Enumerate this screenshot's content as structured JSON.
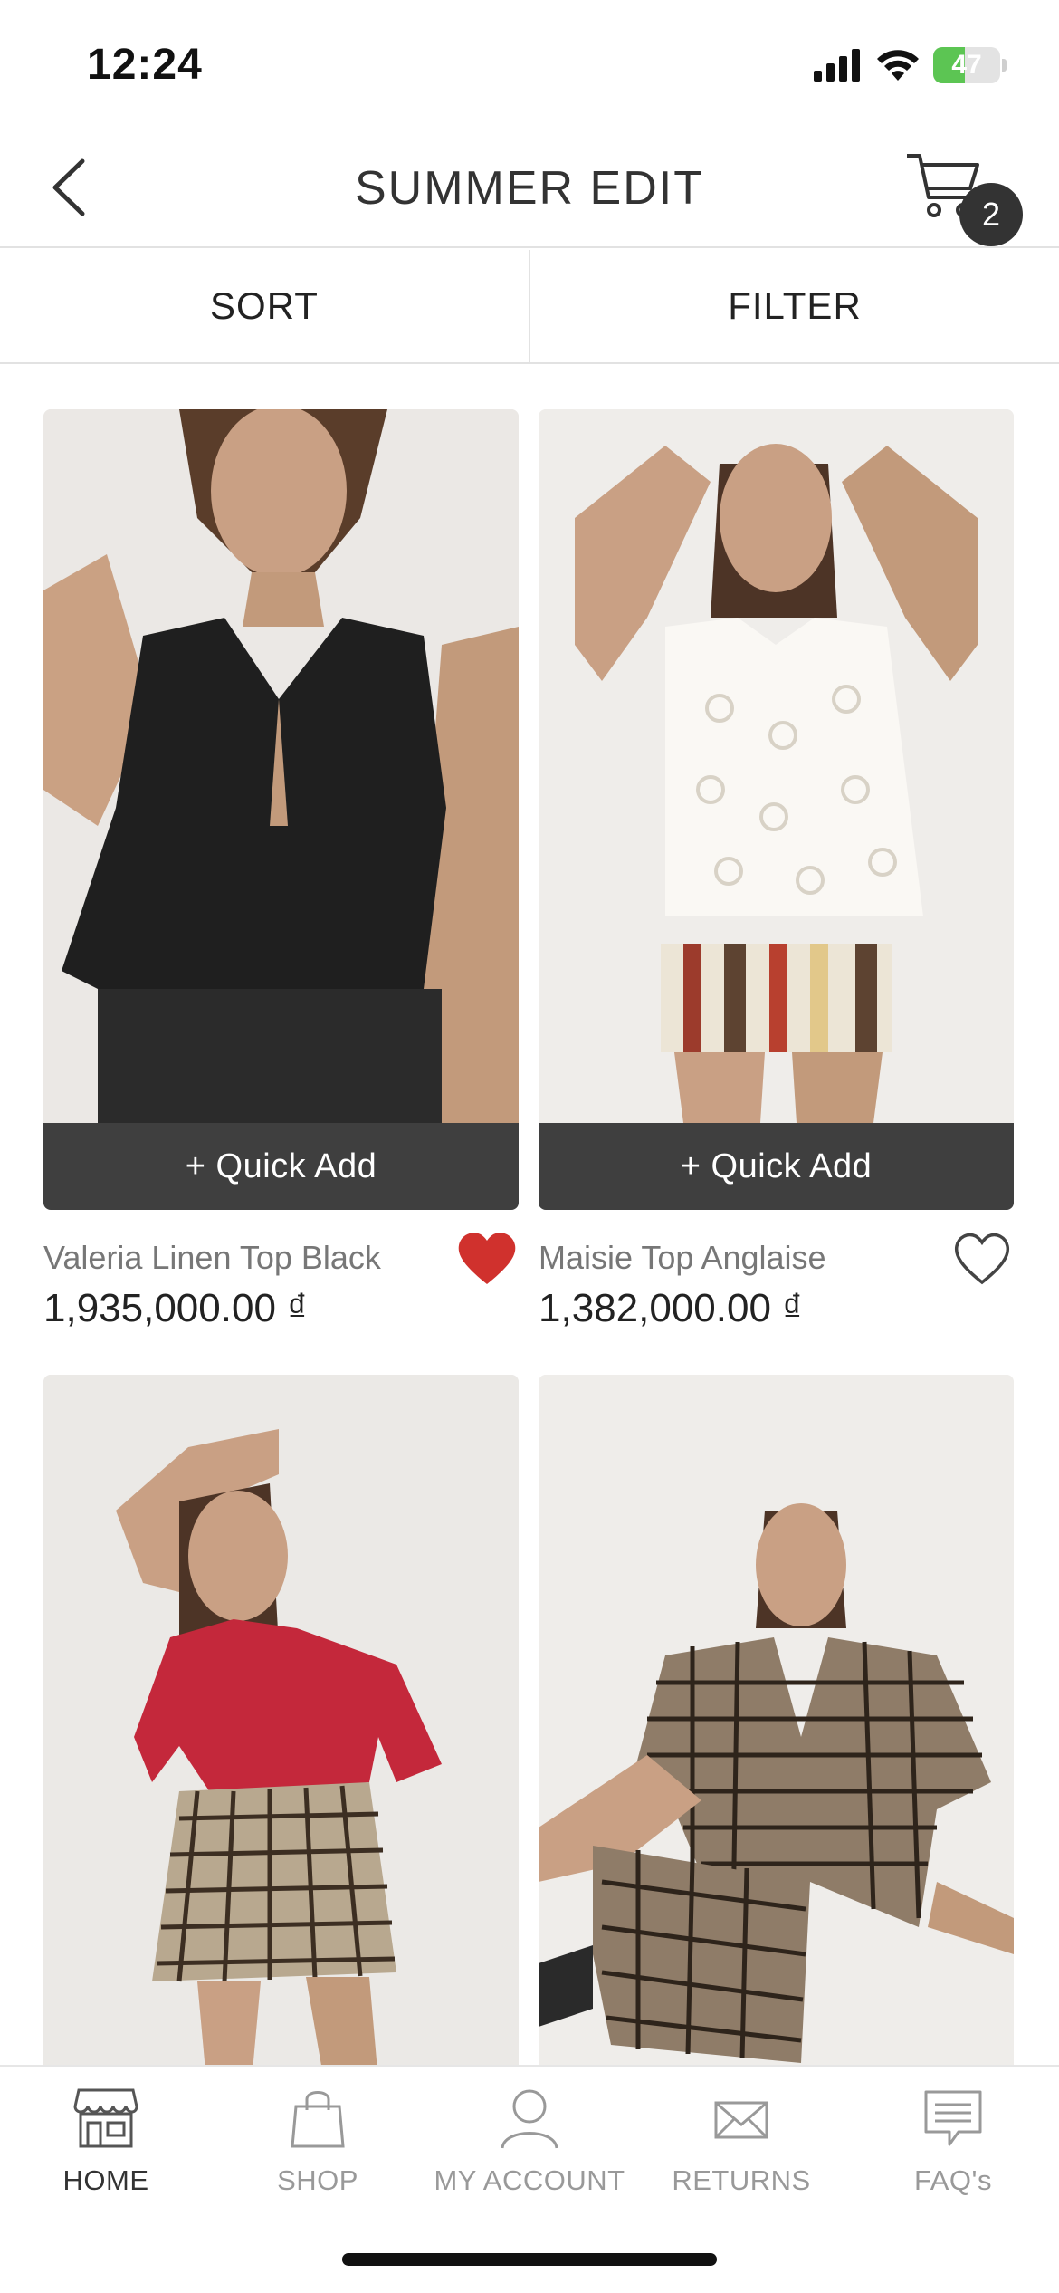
{
  "status_bar": {
    "time": "12:24",
    "battery_percent": 47,
    "battery_label": "47",
    "icons": [
      "cellular-signal-icon",
      "wifi-icon",
      "battery-charging-icon"
    ]
  },
  "nav": {
    "title": "SUMMER EDIT",
    "cart_count": "2",
    "icons": [
      "chevron-left-icon",
      "cart-icon"
    ]
  },
  "controls": {
    "sort_label": "SORT",
    "filter_label": "FILTER"
  },
  "products": [
    {
      "name": "Valeria Linen Top Black",
      "price": "1,935,000.00 ₫",
      "quick_add_label": "+ Quick Add",
      "favorited": true,
      "image": "model wearing black pleated sleeveless tie-front top"
    },
    {
      "name": "Maisie Top Anglaise",
      "price": "1,382,000.00 ₫",
      "quick_add_label": "+ Quick Add",
      "favorited": false,
      "image": "model wearing white eyelet sleeveless top and striped shorts"
    },
    {
      "image": "model wearing red t-shirt and gingham shorts"
    },
    {
      "image": "model wearing gingham tie-front top and shorts seated"
    }
  ],
  "tab_bar": {
    "tabs": [
      {
        "label": "HOME",
        "icon": "storefront-icon",
        "active": true
      },
      {
        "label": "SHOP",
        "icon": "shopping-bag-icon",
        "active": false
      },
      {
        "label": "MY ACCOUNT",
        "icon": "user-icon",
        "active": false
      },
      {
        "label": "RETURNS",
        "icon": "envelope-icon",
        "active": false
      },
      {
        "label": "FAQ's",
        "icon": "chat-bubble-icon",
        "active": false
      }
    ]
  },
  "colors": {
    "accent_heart": "#d0312d",
    "quick_add_bg": "#3f3f3f",
    "battery_green": "#5cc553"
  }
}
